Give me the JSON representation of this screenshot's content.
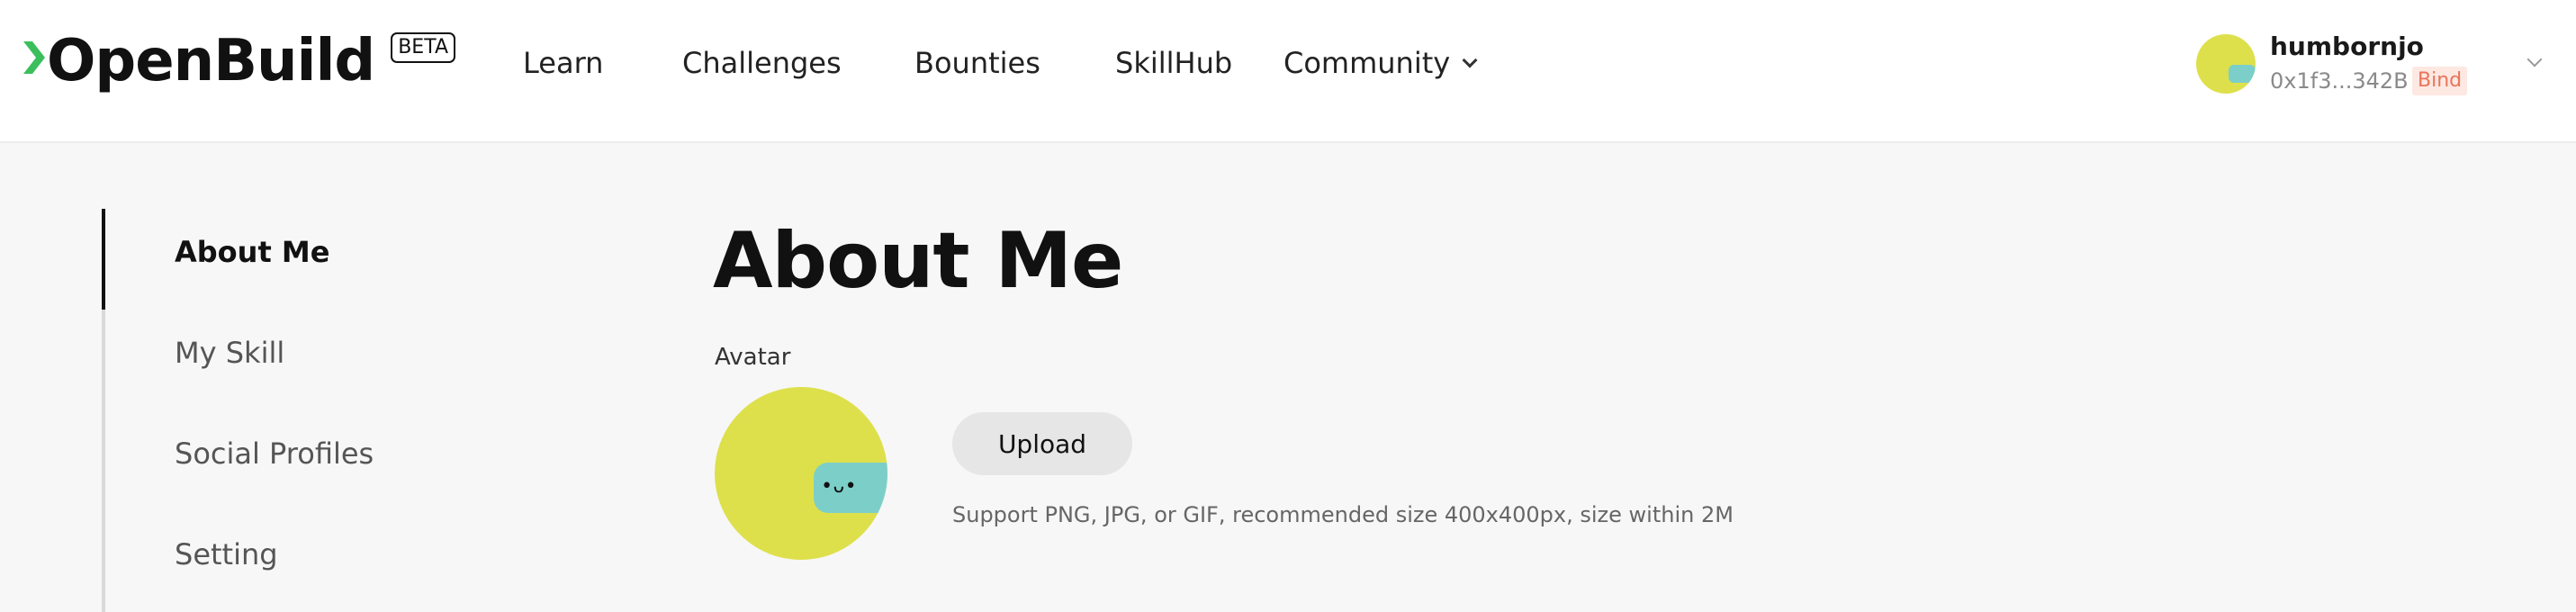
{
  "brand": {
    "name": "OpenBuild",
    "badge": "BETA",
    "accent": "#3bbf5c"
  },
  "nav": {
    "items": [
      {
        "label": "Learn"
      },
      {
        "label": "Challenges"
      },
      {
        "label": "Bounties"
      },
      {
        "label": "SkillHub"
      },
      {
        "label": "Community"
      }
    ]
  },
  "user": {
    "name": "humbornjo",
    "address": "0x1f3...342B",
    "bind_label": "Bind"
  },
  "sidebar": {
    "items": [
      {
        "label": "About Me"
      },
      {
        "label": "My Skill"
      },
      {
        "label": "Social Profiles"
      },
      {
        "label": "Setting"
      }
    ]
  },
  "main": {
    "title": "About Me",
    "avatar_label": "Avatar",
    "upload_label": "Upload",
    "upload_hint": "Support PNG, JPG, or GIF, recommended size 400x400px, size within 2M"
  },
  "colors": {
    "avatar_yellow": "#dde04b",
    "avatar_teal": "#7ccfc9",
    "bind_red": "#e8755a"
  }
}
